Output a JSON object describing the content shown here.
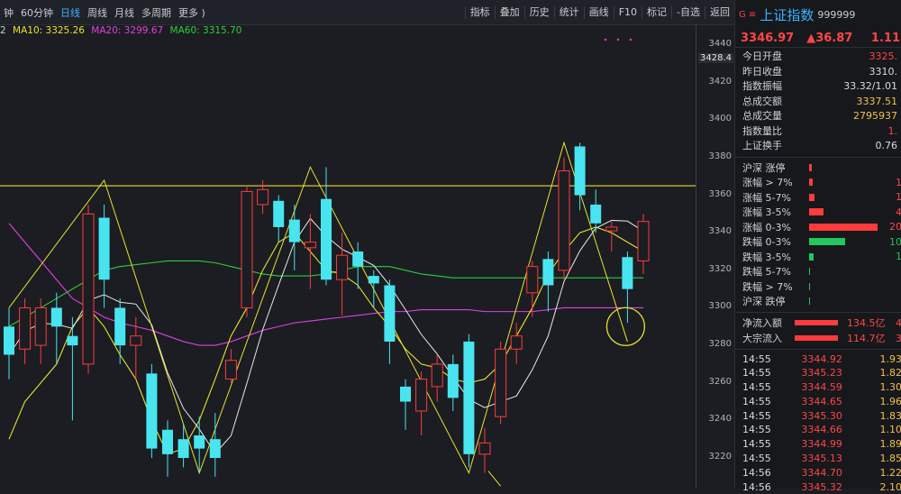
{
  "toolbar": {
    "periods": [
      "钟",
      "60分钟",
      "日线",
      "周线",
      "月线",
      "多周期",
      "更多 )"
    ],
    "active_period": 2,
    "tools": [
      "指标",
      "叠加",
      "历史",
      "统计",
      "画线",
      "F10",
      "标记",
      "-自选",
      "返回"
    ]
  },
  "legend": {
    "prefix": "2",
    "ma10": "MA10: 3325.26",
    "ma20": "MA20: 3299.67",
    "ma60": "MA60: 3315.70",
    "colors": {
      "ma10": "#e8e230",
      "ma20": "#e040e0",
      "ma60": "#2ecc40"
    }
  },
  "y_axis": {
    "labels": [
      "3440",
      "3420",
      "3400",
      "3380",
      "3360",
      "3340",
      "3320",
      "3300",
      "3280",
      "3260",
      "3240",
      "3220"
    ],
    "highlight": "3428.4"
  },
  "chart_data": {
    "type": "candlestick",
    "ylim": [
      3210,
      3450
    ],
    "resistance_line": 3365,
    "candles": [
      {
        "o": 3290,
        "c": 3275,
        "h": 3300,
        "l": 3262
      },
      {
        "o": 3278,
        "c": 3300,
        "h": 3305,
        "l": 3270
      },
      {
        "o": 3280,
        "c": 3300,
        "h": 3305,
        "l": 3270
      },
      {
        "o": 3300,
        "c": 3290,
        "h": 3308,
        "l": 3270
      },
      {
        "o": 3285,
        "c": 3280,
        "h": 3295,
        "l": 3240
      },
      {
        "o": 3270,
        "c": 3350,
        "h": 3355,
        "l": 3265
      },
      {
        "o": 3348,
        "c": 3315,
        "h": 3355,
        "l": 3300
      },
      {
        "o": 3300,
        "c": 3280,
        "h": 3305,
        "l": 3270
      },
      {
        "o": 3280,
        "c": 3285,
        "h": 3295,
        "l": 3262
      },
      {
        "o": 3265,
        "c": 3225,
        "h": 3270,
        "l": 3220
      },
      {
        "o": 3235,
        "c": 3222,
        "h": 3240,
        "l": 3210
      },
      {
        "o": 3230,
        "c": 3220,
        "h": 3238,
        "l": 3215
      },
      {
        "o": 3232,
        "c": 3225,
        "h": 3242,
        "l": 3212
      },
      {
        "o": 3230,
        "c": 3220,
        "h": 3244,
        "l": 3210
      },
      {
        "o": 3262,
        "c": 3272,
        "h": 3278,
        "l": 3260
      },
      {
        "o": 3300,
        "c": 3362,
        "h": 3365,
        "l": 3295
      },
      {
        "o": 3355,
        "c": 3363,
        "h": 3368,
        "l": 3350
      },
      {
        "o": 3357,
        "c": 3343,
        "h": 3360,
        "l": 3335
      },
      {
        "o": 3347,
        "c": 3335,
        "h": 3355,
        "l": 3320
      },
      {
        "o": 3332,
        "c": 3335,
        "h": 3350,
        "l": 3310
      },
      {
        "o": 3358,
        "c": 3315,
        "h": 3375,
        "l": 3312
      },
      {
        "o": 3315,
        "c": 3328,
        "h": 3340,
        "l": 3296
      },
      {
        "o": 3330,
        "c": 3322,
        "h": 3335,
        "l": 3310
      },
      {
        "o": 3317,
        "c": 3313,
        "h": 3320,
        "l": 3300
      },
      {
        "o": 3312,
        "c": 3282,
        "h": 3315,
        "l": 3270
      },
      {
        "o": 3258,
        "c": 3250,
        "h": 3262,
        "l": 3235
      },
      {
        "o": 3245,
        "c": 3262,
        "h": 3266,
        "l": 3232
      },
      {
        "o": 3258,
        "c": 3270,
        "h": 3275,
        "l": 3250
      },
      {
        "o": 3270,
        "c": 3252,
        "h": 3275,
        "l": 3245
      },
      {
        "o": 3282,
        "c": 3222,
        "h": 3286,
        "l": 3215
      },
      {
        "o": 3222,
        "c": 3228,
        "h": 3236,
        "l": 3212
      },
      {
        "o": 3242,
        "c": 3278,
        "h": 3282,
        "l": 3238
      },
      {
        "o": 3278,
        "c": 3285,
        "h": 3292,
        "l": 3270
      },
      {
        "o": 3308,
        "c": 3322,
        "h": 3325,
        "l": 3295
      },
      {
        "o": 3326,
        "c": 3312,
        "h": 3330,
        "l": 3298
      },
      {
        "o": 3320,
        "c": 3373,
        "h": 3380,
        "l": 3315
      },
      {
        "o": 3386,
        "c": 3360,
        "h": 3388,
        "l": 3352
      },
      {
        "o": 3355,
        "c": 3345,
        "h": 3363,
        "l": 3340
      },
      {
        "o": 3341,
        "c": 3343,
        "h": 3346,
        "l": 3330
      },
      {
        "o": 3327,
        "c": 3310,
        "h": 3330,
        "l": 3292
      },
      {
        "o": 3325,
        "c": 3346,
        "h": 3350,
        "l": 3318
      }
    ],
    "ma10": [
      3230,
      3250,
      3260,
      3270,
      3290,
      3300,
      3290,
      3275,
      3262,
      3240,
      3222,
      3225,
      3240,
      3262,
      3285,
      3300,
      3320,
      3335,
      3340,
      3330,
      3320,
      3318,
      3312,
      3300,
      3290,
      3278,
      3270,
      3268,
      3262,
      3260,
      3262,
      3270,
      3285,
      3300,
      3318,
      3330,
      3340,
      3343,
      3340,
      3335,
      3330
    ],
    "ma20": [
      3345,
      3335,
      3325,
      3315,
      3305,
      3300,
      3295,
      3292,
      3290,
      3288,
      3285,
      3282,
      3280,
      3280,
      3282,
      3285,
      3288,
      3290,
      3292,
      3293,
      3294,
      3295,
      3296,
      3297,
      3298,
      3298,
      3299,
      3299,
      3299,
      3299,
      3298,
      3298,
      3298,
      3298,
      3299,
      3300,
      3300,
      3300,
      3300,
      3300,
      3300
    ],
    "ma60": [
      3290,
      3295,
      3300,
      3305,
      3310,
      3315,
      3320,
      3322,
      3323,
      3324,
      3325,
      3325,
      3325,
      3324,
      3322,
      3320,
      3318,
      3317,
      3317,
      3317,
      3318,
      3320,
      3322,
      3322,
      3322,
      3320,
      3318,
      3317,
      3316,
      3316,
      3316,
      3316,
      3316,
      3316,
      3316,
      3316,
      3316,
      3316,
      3316,
      3316,
      3316
    ]
  },
  "panel": {
    "flag": "G ≡",
    "title": "上证指数",
    "code": "999999",
    "price": "3346.97",
    "change": "▲36.87",
    "pct": "1.11",
    "stats": [
      {
        "label": "今日开盘",
        "value": "3325.",
        "color": "#ff4646"
      },
      {
        "label": "昨日收盘",
        "value": "3310.",
        "color": "#d8dadd"
      },
      {
        "label": "指数振幅",
        "value": "33.32/1.01",
        "color": "#d8dadd"
      },
      {
        "label": "总成交额",
        "value": "3337.51",
        "color": "#f2c04b"
      },
      {
        "label": "总成交量",
        "value": "2795937",
        "color": "#f2c04b"
      },
      {
        "label": "指数量比",
        "value": "1.",
        "color": "#ff4646"
      },
      {
        "label": "上证换手",
        "value": "0.76",
        "color": "#d8dadd"
      }
    ],
    "dist": [
      {
        "label": "沪深 涨停",
        "bar": 3,
        "color": "#ff3b3b",
        "value": ""
      },
      {
        "label": "涨幅 > 7%",
        "bar": 4,
        "color": "#ff3b3b",
        "value": "1"
      },
      {
        "label": "涨幅 5-7%",
        "bar": 6,
        "color": "#ff3b3b",
        "value": "1"
      },
      {
        "label": "涨幅 3-5%",
        "bar": 16,
        "color": "#ff3b3b",
        "value": "4"
      },
      {
        "label": "涨幅 0-3%",
        "bar": 76,
        "color": "#ff3b3b",
        "value": "20"
      },
      {
        "label": "跌幅 0-3%",
        "bar": 40,
        "color": "#22c55e",
        "value": "10"
      },
      {
        "label": "跌幅 3-5%",
        "bar": 5,
        "color": "#22c55e",
        "value": "1"
      },
      {
        "label": "跌幅 5-7%",
        "bar": 1,
        "color": "#22c55e",
        "value": ""
      },
      {
        "label": "跌幅 > 7%",
        "bar": 1,
        "color": "#22c55e",
        "value": ""
      },
      {
        "label": "沪深 跌停",
        "bar": 1,
        "color": "#22c55e",
        "value": ""
      }
    ],
    "flows": [
      {
        "label": "净流入额",
        "value": "134.5亿",
        "value2": "4"
      },
      {
        "label": "大宗流入",
        "value": "114.7亿",
        "value2": "3"
      }
    ],
    "ticks": [
      {
        "t": "14:55",
        "p": "3344.92",
        "v": "1.93"
      },
      {
        "t": "14:55",
        "p": "3345.23",
        "v": "1.82"
      },
      {
        "t": "14:55",
        "p": "3344.59",
        "v": "1.30"
      },
      {
        "t": "14:55",
        "p": "3344.65",
        "v": "1.96"
      },
      {
        "t": "14:55",
        "p": "3345.30",
        "v": "1.83"
      },
      {
        "t": "14:55",
        "p": "3344.66",
        "v": "1.10"
      },
      {
        "t": "14:55",
        "p": "3344.99",
        "v": "1.89"
      },
      {
        "t": "14:55",
        "p": "3345.13",
        "v": "1.85"
      },
      {
        "t": "14:56",
        "p": "3344.70",
        "v": "1.22"
      },
      {
        "t": "14:56",
        "p": "3345.32",
        "v": "2.10"
      }
    ]
  }
}
